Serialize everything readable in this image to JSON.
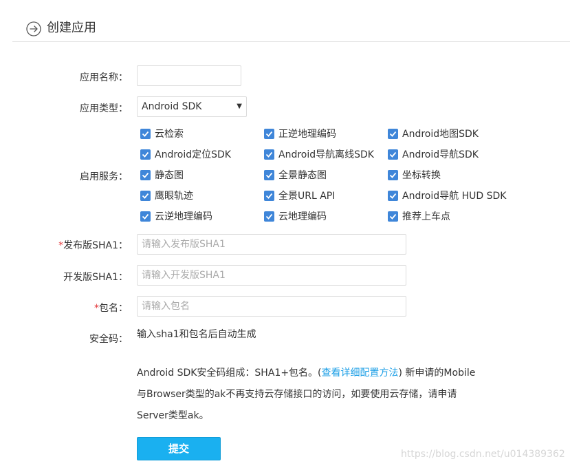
{
  "header": {
    "title": "创建应用"
  },
  "form": {
    "app_name_label": "应用名称：",
    "app_name_value": "",
    "app_type_label": "应用类型：",
    "app_type_value": "Android SDK",
    "services_label": "启用服务：",
    "services": [
      {
        "label": "云检索",
        "checked": true
      },
      {
        "label": "正逆地理编码",
        "checked": true
      },
      {
        "label": "Android地图SDK",
        "checked": true
      },
      {
        "label": "Android定位SDK",
        "checked": true
      },
      {
        "label": "Android导航离线SDK",
        "checked": true
      },
      {
        "label": "Android导航SDK",
        "checked": true
      },
      {
        "label": "静态图",
        "checked": true
      },
      {
        "label": "全景静态图",
        "checked": true
      },
      {
        "label": "坐标转换",
        "checked": true
      },
      {
        "label": "鹰眼轨迹",
        "checked": true
      },
      {
        "label": "全景URL API",
        "checked": true
      },
      {
        "label": "Android导航 HUD SDK",
        "checked": true
      },
      {
        "label": "云逆地理编码",
        "checked": true
      },
      {
        "label": "云地理编码",
        "checked": true
      },
      {
        "label": "推荐上车点",
        "checked": true
      }
    ],
    "required_mark": "*",
    "release_sha1_label": "发布版SHA1：",
    "release_sha1_placeholder": "请输入发布版SHA1",
    "dev_sha1_label": "开发版SHA1：",
    "dev_sha1_placeholder": "请输入开发版SHA1",
    "package_label": "包名：",
    "package_placeholder": "请输入包名",
    "security_code_label": "安全码：",
    "security_code_value": "输入sha1和包名后自动生成"
  },
  "note": {
    "line1_prefix": "Android SDK安全码组成：SHA1+包名。(",
    "line1_link": "查看详细配置方法",
    "line1_suffix": ") 新申请的Mobile",
    "line2": "与Browser类型的ak不再支持云存储接口的访问，如要使用云存储，请申请",
    "line3": "Server类型ak。"
  },
  "submit_label": "提交",
  "watermark": "https://blog.csdn.net/u014389362",
  "colors": {
    "accent": "#1ab0f0",
    "checkbox": "#3f86d9",
    "link": "#1a9ee6",
    "required": "#e4393c"
  }
}
